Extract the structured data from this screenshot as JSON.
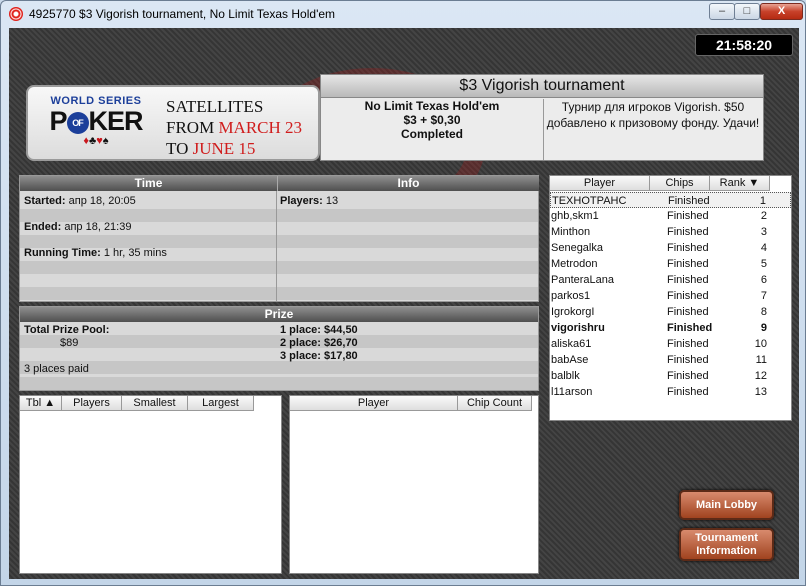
{
  "window": {
    "title": "4925770 $3 Vigorish tournament, No Limit Texas Hold'em",
    "min_label": "–",
    "max_label": "□",
    "close_label": "X"
  },
  "clock": "21:58:20",
  "banner": {
    "logo_top": "WORLD SERIES",
    "logo_p": "P",
    "logo_o": "OF",
    "logo_rest": "KER",
    "line1": "SATELLITES",
    "line2_a": "FROM ",
    "line2_b": "MARCH 23",
    "line3_a": "TO ",
    "line3_b": "JUNE 15"
  },
  "tournament": {
    "title": "$3 Vigorish tournament",
    "game": "No Limit Texas Hold'em",
    "buyin": "$3 + $0,30",
    "status": "Completed",
    "description": "Турнир для игроков Vigorish. $50 добавлено к призовому фонду. Удачи!"
  },
  "time_panel": {
    "header": "Time",
    "started_label": "Started:",
    "started_value": "апр 18, 20:05",
    "ended_label": "Ended:",
    "ended_value": "апр 18, 21:39",
    "running_label": "Running Time:",
    "running_value": "1 hr, 35 mins"
  },
  "info_panel": {
    "header": "Info",
    "players_label": "Players:",
    "players_value": "13"
  },
  "prize_panel": {
    "header": "Prize",
    "pool_label": "Total Prize Pool:",
    "pool_value": "$89",
    "places_paid": "3 places paid",
    "places": [
      {
        "label": "1 place:",
        "value": "$44,50"
      },
      {
        "label": "2 place:",
        "value": "$26,70"
      },
      {
        "label": "3 place:",
        "value": "$17,80"
      }
    ]
  },
  "tables_list": {
    "columns": [
      "Tbl",
      "Players",
      "Smallest",
      "Largest"
    ]
  },
  "chip_list": {
    "columns": [
      "Player",
      "Chip Count"
    ]
  },
  "players_list": {
    "columns": [
      "Player",
      "Chips",
      "Rank"
    ],
    "rows": [
      {
        "name": "ТЕХНОТРАНС",
        "chips": "Finished",
        "rank": "1"
      },
      {
        "name": "ghb,skm1",
        "chips": "Finished",
        "rank": "2"
      },
      {
        "name": "Minthon",
        "chips": "Finished",
        "rank": "3"
      },
      {
        "name": "Senegalka",
        "chips": "Finished",
        "rank": "4"
      },
      {
        "name": "Metrodon",
        "chips": "Finished",
        "rank": "5"
      },
      {
        "name": "PanteraLana",
        "chips": "Finished",
        "rank": "6"
      },
      {
        "name": "parkos1",
        "chips": "Finished",
        "rank": "7"
      },
      {
        "name": "IgrokorgI",
        "chips": "Finished",
        "rank": "8"
      },
      {
        "name": "vigorishru",
        "chips": "Finished",
        "rank": "9"
      },
      {
        "name": "aliska61",
        "chips": "Finished",
        "rank": "10"
      },
      {
        "name": "babAse",
        "chips": "Finished",
        "rank": "11"
      },
      {
        "name": "balblk",
        "chips": "Finished",
        "rank": "12"
      },
      {
        "name": "l11arson",
        "chips": "Finished",
        "rank": "13"
      }
    ]
  },
  "buttons": {
    "main_lobby": "Main Lobby",
    "tournament_info_1": "Tournament",
    "tournament_info_2": "Information"
  }
}
